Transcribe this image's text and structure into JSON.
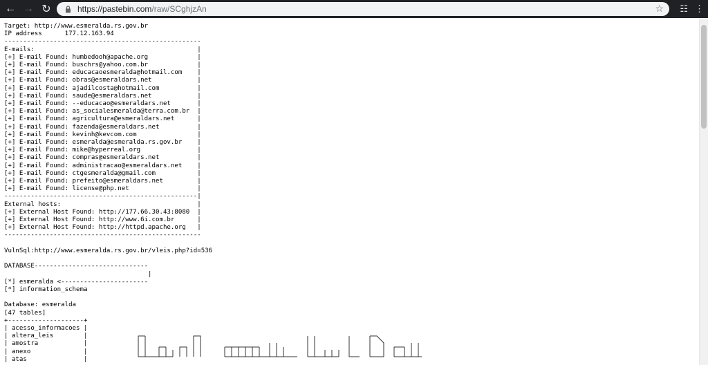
{
  "browser": {
    "url_host": "https://pastebin.com",
    "url_path": "/raw/SCghjzAn",
    "icons": [
      "back-arrow-icon",
      "forward-arrow-icon",
      "reload-icon",
      "lock-icon",
      "star-icon",
      "extension-icon",
      "menu-dots-icon"
    ]
  },
  "page": {
    "lines": [
      "Target: http://www.esmeralda.rs.gov.br",
      "IP address      177.12.163.94",
      "----------------------------------------------------",
      "E-mails:                                           |",
      "[+] E-mail Found: humbedooh@apache.org             |",
      "[+] E-mail Found: buschrs@yahoo.com.br             |",
      "[+] E-mail Found: educacaoesmeralda@hotmail.com    |",
      "[+] E-mail Found: obras@esmeraldars.net            |",
      "[+] E-mail Found: ajadilcosta@hotmail.com          |",
      "[+] E-mail Found: saude@esmeraldars.net            |",
      "[+] E-mail Found: --educacao@esmeraldars.net       |",
      "[+] E-mail Found: as_socialesmeralda@terra.com.br  |",
      "[+] E-mail Found: agricultura@esmeraldars.net      |",
      "[+] E-mail Found: fazenda@esmeraldars.net          |",
      "[+] E-mail Found: kevinh@kevcom.com                |",
      "[+] E-mail Found: esmeralda@esmeralda.rs.gov.br    |",
      "[+] E-mail Found: mike@hyperreal.org               |",
      "[+] E-mail Found: compras@esmeraldars.net          |",
      "[+] E-mail Found: administracao@esmeraldars.net    |",
      "[+] E-mail Found: ctgesmeralda@gmail.com           |",
      "[+] E-mail Found: prefeito@esmeraldars.net         |",
      "[+] E-mail Found: license@php.net                  |",
      "---------------------------------------------------|",
      "External hosts:                                    |",
      "[+] External Host Found: http://177.66.30.43:8080  |",
      "[+] External Host Found: http://www.6i.com.br      |",
      "[+] External Host Found: http://httpd.apache.org   |",
      "----------------------------------------------------",
      "",
      "VulnSql:http://www.esmeralda.rs.gov.br/vleis.php?id=536",
      "",
      "DATABASE------------------------------",
      "                                      |",
      "[*] esmeralda <-----------------------",
      "[*] information_schema",
      "",
      "Database: esmeralda",
      "[47 tables]",
      "+--------------------+",
      "| acesso_informacoes |",
      "| altera_leis        |",
      "| amostra            |",
      "| anexo              |",
      "| atas               |"
    ]
  }
}
